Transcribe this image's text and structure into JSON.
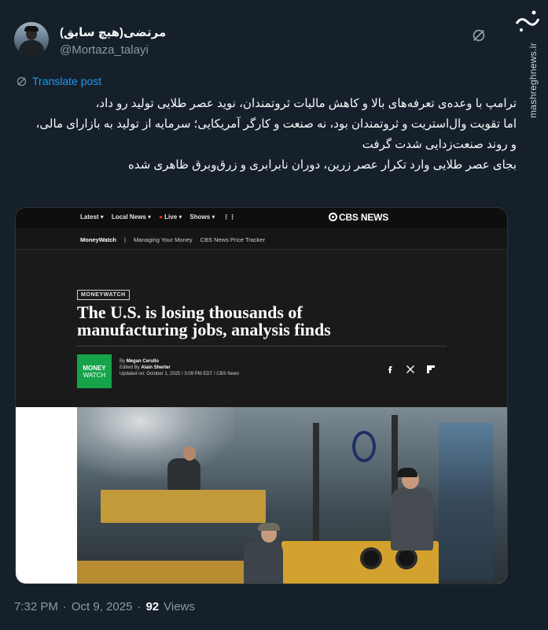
{
  "author": {
    "display_name": "مرتضی(هیچ سابق)",
    "handle": "@Mortaza_talayi"
  },
  "watermark": {
    "logo_text": "مشرق",
    "url": "mashreghnews.ir"
  },
  "translate_label": "Translate post",
  "tweet": {
    "lines": [
      "ترامپ با وعده‌ی تعرفه‌های بالا و کاهش مالیات ثروتمندان، نوید عصر طلایی تولید رو داد،",
      "اما تقویت وال‌استریت و ثروتمندان بود، نه صنعت و کارگر آمریکایی؛ سرمایه از تولید به بازارای مالی، و روند صنعت‌زدایی شدت گرفت",
      "بجای عصر طلایی وارد تکرار عصر زرین، دوران نابرابری و زرق‌وبرق ظاهری شده"
    ]
  },
  "card": {
    "nav": [
      "Latest",
      "Local News",
      "Live",
      "Shows"
    ],
    "brand": "CBS NEWS",
    "subnav": [
      "MoneyWatch",
      "|",
      "Managing Your Money",
      "CBS News Price Tracker"
    ],
    "badge": "MONEYWATCH",
    "headline": "The U.S. is losing thousands of manufacturing jobs, analysis finds",
    "logo_top": "MONEY",
    "logo_bottom": "WATCH",
    "byline_prefix": "By",
    "author": "Megan Cerullo",
    "edited_prefix": "Edited By",
    "editor": "Alain Sherter",
    "updated": "Updated on: October 1, 2025 / 3:09 PM EDT / CBS News"
  },
  "meta": {
    "time": "7:32 PM",
    "separator": "·",
    "date": "Oct 9, 2025",
    "views_count": "92",
    "views_label": "Views"
  },
  "colors": {
    "background": "#15202b",
    "link": "#1d9bf0",
    "muted": "#8b98a5",
    "moneywatch_green": "#16a34a"
  }
}
